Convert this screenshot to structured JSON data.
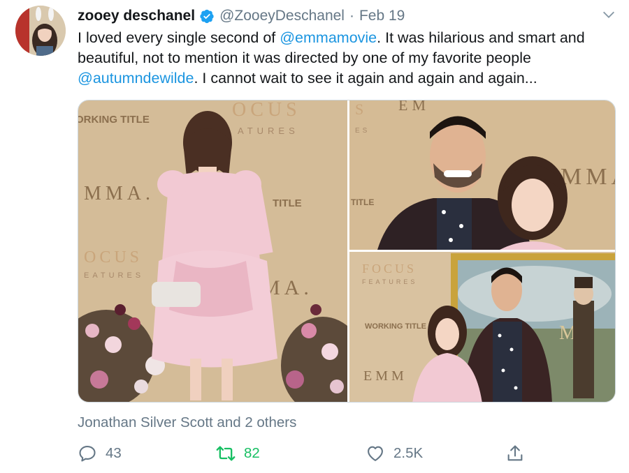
{
  "tweet": {
    "author_name": "zooey deschanel",
    "author_handle": "@ZooeyDeschanel",
    "separator": "·",
    "date": "Feb 19",
    "text_part1": "I loved every single second of ",
    "mention1": "@emmamovie",
    "text_part2": ". It was hilarious and smart and beautiful, not to mention it was directed by one of my favorite people ",
    "mention2": "@autumndewilde",
    "text_part3": ". I cannot wait to see it again and again and again...",
    "liked_by": "Jonathan Silver Scott and 2 others"
  },
  "photos": {
    "p1": {
      "banner_a": "ORKING TITLE",
      "banner_b": "OCUS",
      "banner_c": "ATURES",
      "banner_d": "MMA.",
      "banner_e": "TITLE",
      "banner_f": "OCUS",
      "banner_g": "EATURES",
      "banner_h": "MA."
    },
    "p2": {
      "banner_a": "S",
      "banner_b": "ES",
      "banner_c": "EM",
      "banner_d": "TITLE",
      "banner_e": "MMA"
    },
    "p3": {
      "banner_a": "FOCUS",
      "banner_b": "FEATURES",
      "banner_c": "WORKING TITLE",
      "banner_d": "EMM",
      "banner_e": "MA"
    }
  },
  "actions": {
    "reply_count": "43",
    "retweet_count": "82",
    "like_count": "2.5K"
  },
  "colors": {
    "link": "#1b95e0",
    "retweet": "#17bf63",
    "muted": "#657786",
    "verified": "#1da1f2"
  },
  "icons": [
    "verified-badge-icon",
    "chevron-down-icon",
    "reply-icon",
    "retweet-icon",
    "like-icon",
    "share-icon"
  ]
}
